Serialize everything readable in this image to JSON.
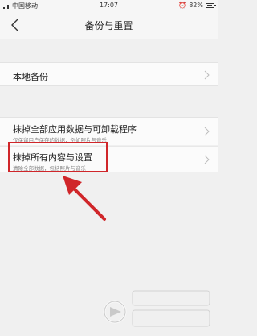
{
  "status_bar": {
    "carrier": "中国移动",
    "time": "17:07",
    "battery": "82%"
  },
  "header": {
    "title": "备份与重置"
  },
  "rows": {
    "local_backup": {
      "label": "本地备份"
    },
    "erase_apps": {
      "label": "抹掉全部应用数据与可卸载程序",
      "sub": "仅保留用户保存的数据，例如照片与音乐"
    },
    "erase_all": {
      "label": "抹掉所有内容与设置",
      "sub": "清除全部数据，包括照片与音乐"
    }
  },
  "colors": {
    "highlight": "#d0262a",
    "background": "#f0f0f0"
  },
  "icons": [
    "back-arrow-icon",
    "chevron-right-icon",
    "signal-icon",
    "battery-icon"
  ]
}
